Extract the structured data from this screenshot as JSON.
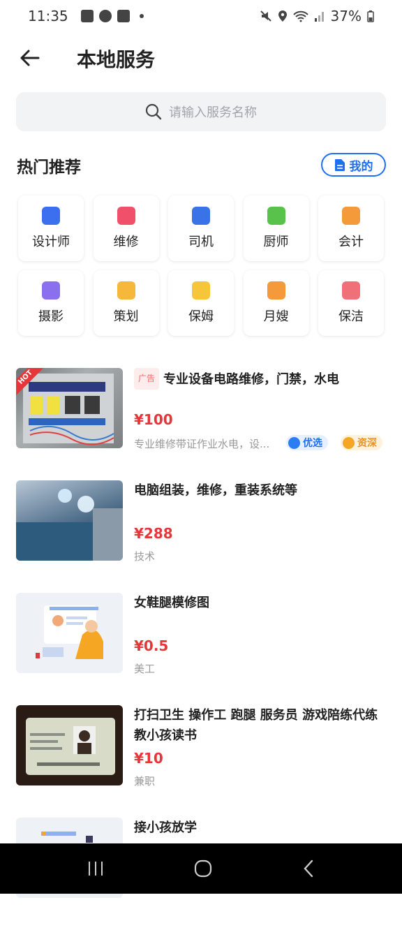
{
  "status_bar": {
    "time": "11:35",
    "battery": "37%"
  },
  "header": {
    "title": "本地服务"
  },
  "search": {
    "placeholder": "请输入服务名称"
  },
  "hot": {
    "title": "热门推荐",
    "mine_label": "我的",
    "categories": [
      {
        "label": "设计师",
        "icon": "ruler-pencil-icon",
        "color": "#3b6ff0"
      },
      {
        "label": "维修",
        "icon": "house-repair-icon",
        "color": "#f0506a"
      },
      {
        "label": "司机",
        "icon": "car-icon",
        "color": "#3a72e8"
      },
      {
        "label": "厨师",
        "icon": "chef-hat-icon",
        "color": "#58c24a"
      },
      {
        "label": "会计",
        "icon": "folder-icon",
        "color": "#f59a3a"
      },
      {
        "label": "摄影",
        "icon": "video-camera-icon",
        "color": "#8a70ee"
      },
      {
        "label": "策划",
        "icon": "document-icon",
        "color": "#f5b83a"
      },
      {
        "label": "保姆",
        "icon": "bowl-icon",
        "color": "#f5c53a"
      },
      {
        "label": "月嫂",
        "icon": "baby-bottle-icon",
        "color": "#f59a3a"
      },
      {
        "label": "保洁",
        "icon": "broom-icon",
        "color": "#f0707a"
      }
    ]
  },
  "listings": [
    {
      "title": "专业设备电路维修，门禁，水电",
      "ad": "广告",
      "hot": "HOT",
      "price": "¥100",
      "desc": "专业维修带证作业水电，设...",
      "badge1": "优选",
      "badge2": "资深",
      "thumb": "electrical-panel"
    },
    {
      "title": "电脑组装，维修，重装系统等",
      "price": "¥288",
      "desc": "技术",
      "thumb": "computer"
    },
    {
      "title": "女鞋腿模修图",
      "price": "¥0.5",
      "desc": "美工",
      "thumb": "illustration"
    },
    {
      "title": "打扫卫生 操作工 跑腿  服务员  游戏陪练代练 教小孩读书",
      "price": "¥10",
      "desc": "兼职",
      "thumb": "id-card"
    },
    {
      "title": "接小孩放学",
      "thumb": "illustration"
    }
  ]
}
